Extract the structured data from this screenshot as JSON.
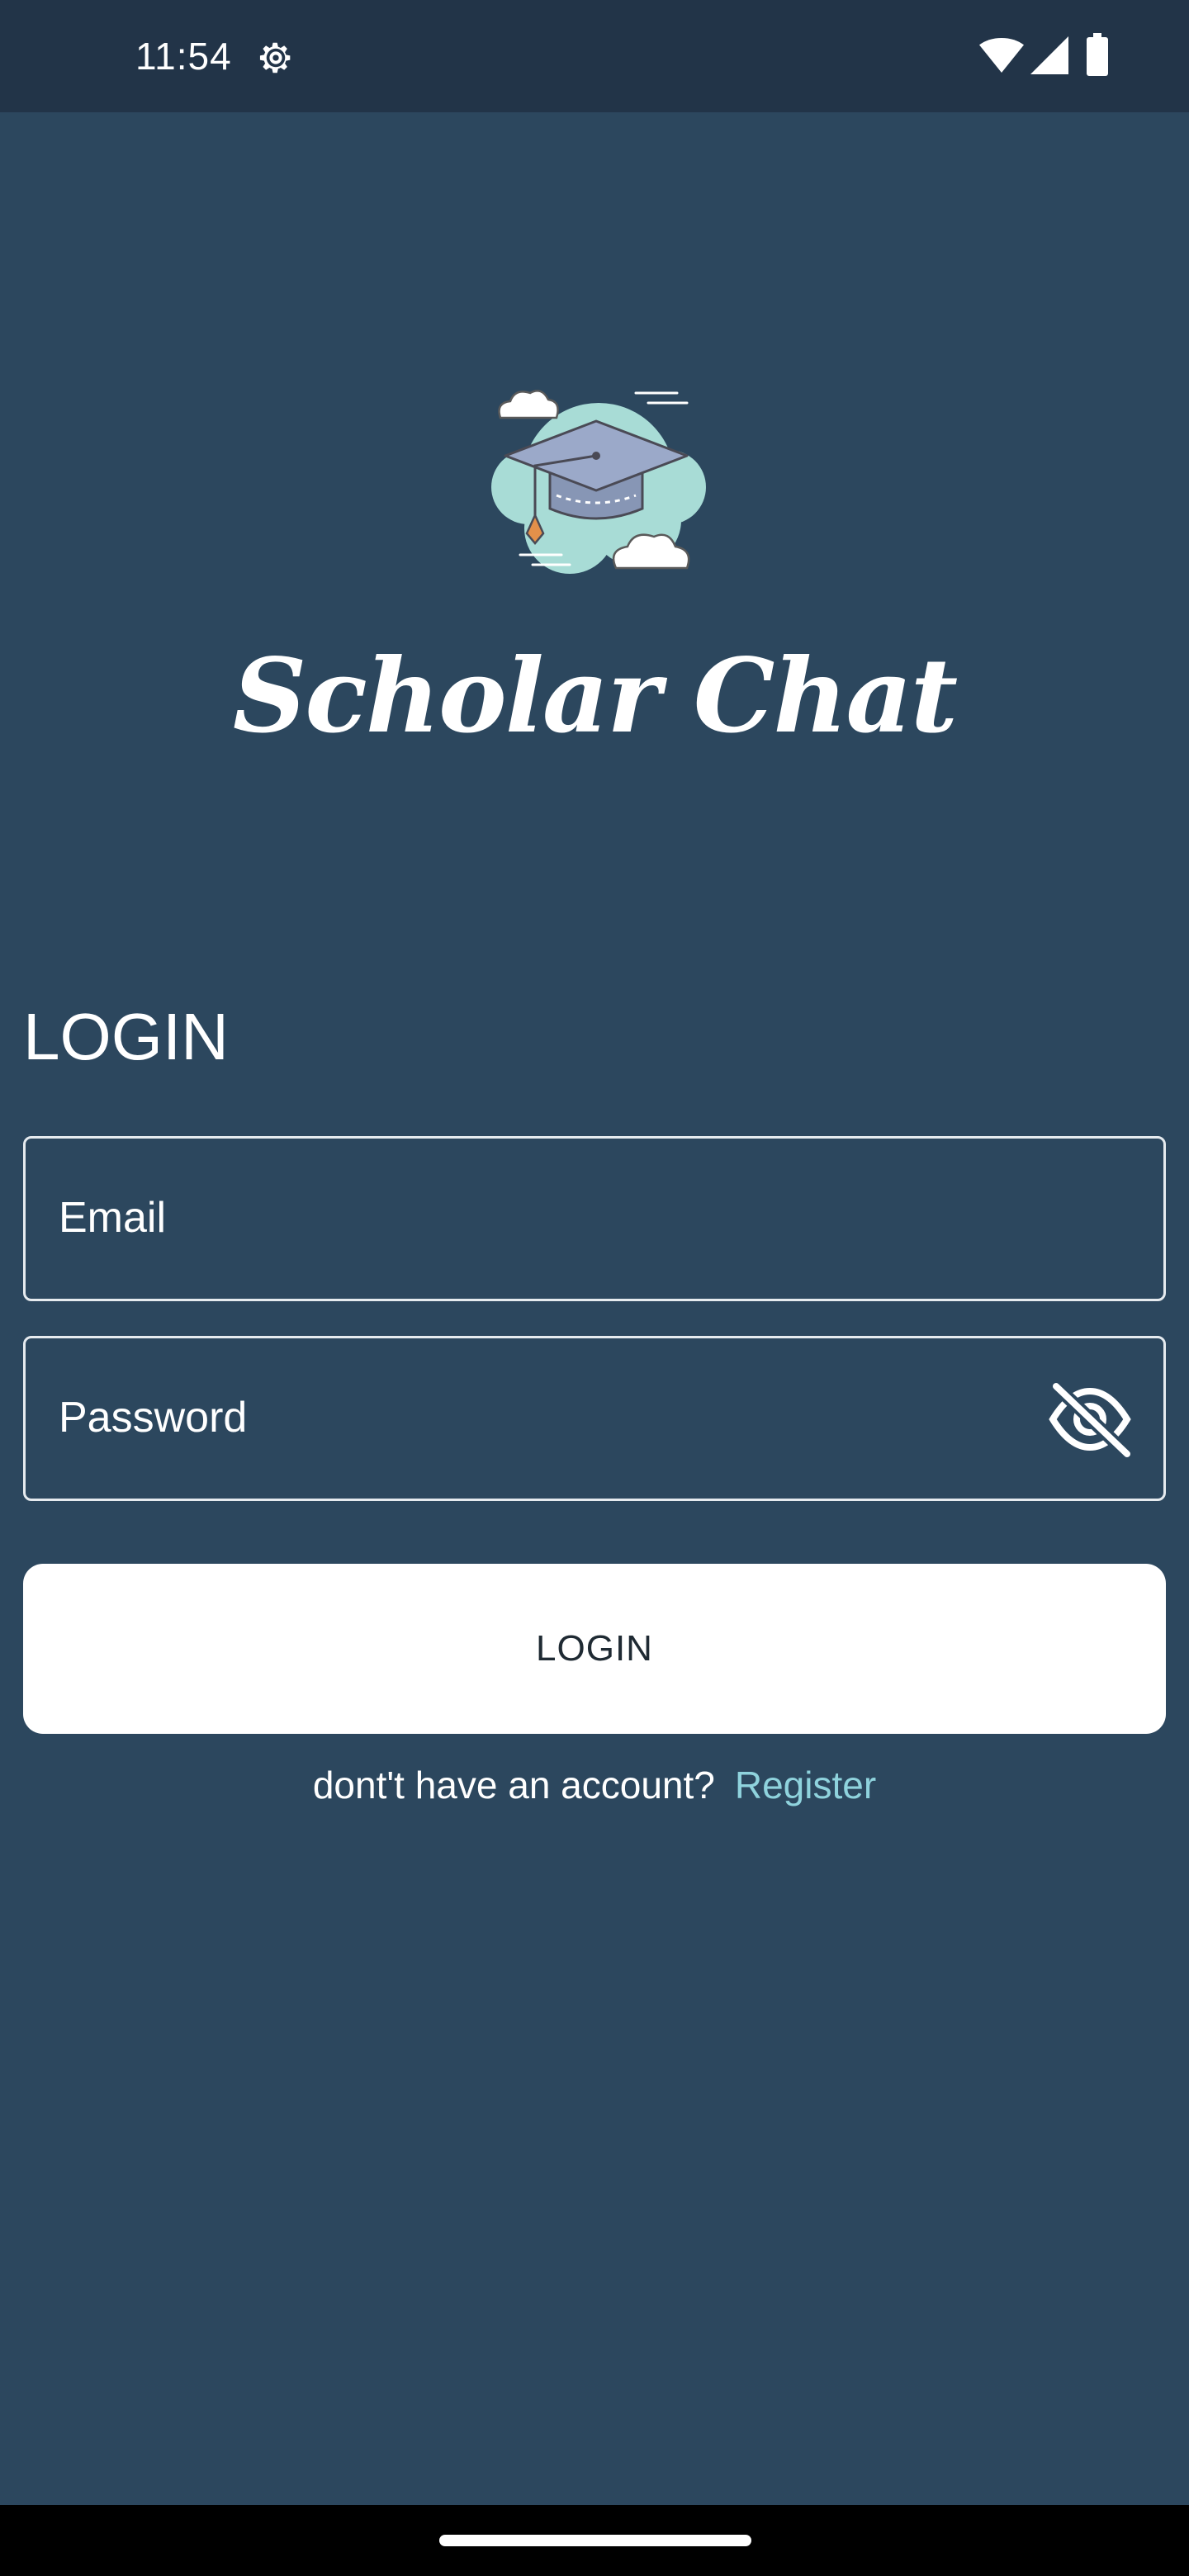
{
  "status_bar": {
    "time": "11:54",
    "icons": [
      "gear-icon",
      "wifi-icon",
      "signal-icon",
      "battery-icon"
    ]
  },
  "app": {
    "name": "Scholar Chat",
    "logo_icon": "graduation-cap-cloud-logo"
  },
  "login": {
    "heading": "LOGIN",
    "email_placeholder": "Email",
    "password_placeholder": "Password",
    "password_toggle_icon": "eye-off-icon",
    "button_label": "LOGIN",
    "register_prompt": "dont't have an account?",
    "register_link": "Register"
  },
  "colors": {
    "background": "#2c475e",
    "status_bar": "#223448",
    "accent_link": "#8fd3dd",
    "button_bg": "#ffffff"
  }
}
